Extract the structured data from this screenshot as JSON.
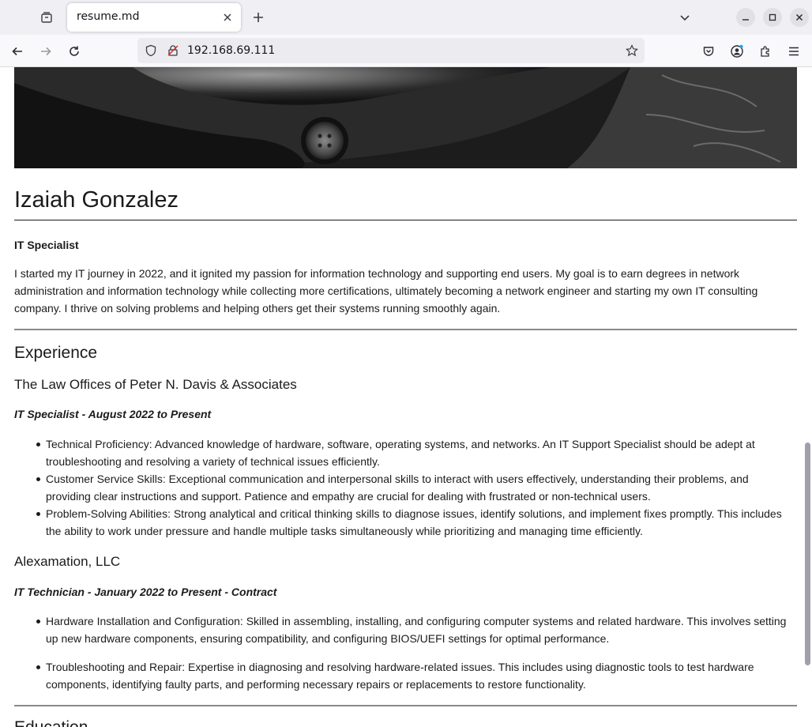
{
  "browser": {
    "tab_title": "resume.md",
    "url": "192.168.69.111"
  },
  "resume": {
    "name": "Izaiah Gonzalez",
    "role": "IT Specialist",
    "summary": "I started my IT journey in 2022, and it ignited my passion for information technology and supporting end users. My goal is to earn degrees in network administration and information technology while collecting more certifications, ultimately becoming a network engineer and starting my own IT consulting company. I thrive on solving problems and helping others get their systems running smoothly again.",
    "experience_heading": "Experience",
    "jobs": [
      {
        "company": "The Law Offices of Peter N. Davis & Associates",
        "title": "IT Specialist - August 2022 to Present",
        "bullets": [
          "Technical Proficiency: Advanced knowledge of hardware, software, operating systems, and networks. An IT Support Specialist should be adept at troubleshooting and resolving a variety of technical issues efficiently.",
          "Customer Service Skills: Exceptional communication and interpersonal skills to interact with users effectively, understanding their problems, and providing clear instructions and support. Patience and empathy are crucial for dealing with frustrated or non-technical users.",
          "Problem-Solving Abilities: Strong analytical and critical thinking skills to diagnose issues, identify solutions, and implement fixes promptly. This includes the ability to work under pressure and handle multiple tasks simultaneously while prioritizing and managing time efficiently."
        ]
      },
      {
        "company": "Alexamation, LLC",
        "title": "IT Technician - January 2022 to Present - Contract",
        "bullets": [
          "Hardware Installation and Configuration: Skilled in assembling, installing, and configuring computer systems and related hardware. This involves setting up new hardware components, ensuring compatibility, and configuring BIOS/UEFI settings for optimal performance.",
          "Troubleshooting and Repair: Expertise in diagnosing and resolving hardware-related issues. This includes using diagnostic tools to test hardware components, identifying faulty parts, and performing necessary repairs or replacements to restore functionality."
        ]
      }
    ],
    "next_heading": "Education"
  }
}
